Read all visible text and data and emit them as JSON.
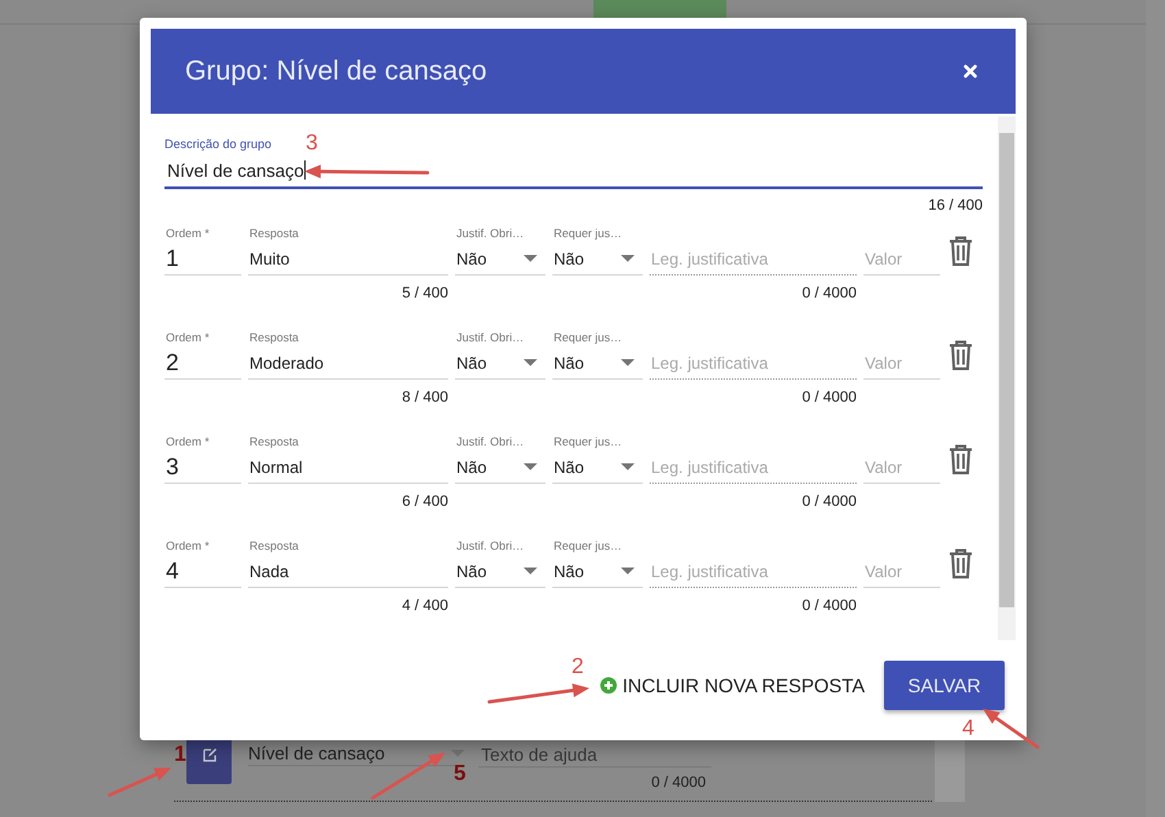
{
  "background_page": {
    "select_value": "Nível de cansaço",
    "help_placeholder": "Texto de ajuda",
    "counter": "0 / 4000"
  },
  "dialog": {
    "title": "Grupo: Nível de cansaço",
    "description_field": {
      "label": "Descrição do grupo",
      "value": "Nível de cansaço",
      "counter": "16 / 400",
      "focused": true
    },
    "answers": [
      {
        "order_label": "Ordem *",
        "order": "1",
        "answer_label": "Resposta",
        "answer": "Muito",
        "answer_counter": "5 / 400",
        "justif_label": "Justif. Obri…",
        "justif_value": "Não",
        "require_label": "Requer jus…",
        "require_value": "Não",
        "legend_placeholder": "Leg. justificativa",
        "legend_counter": "0 / 4000",
        "value_placeholder": "Valor"
      },
      {
        "order_label": "Ordem *",
        "order": "2",
        "answer_label": "Resposta",
        "answer": "Moderado",
        "answer_counter": "8 / 400",
        "justif_label": "Justif. Obri…",
        "justif_value": "Não",
        "require_label": "Requer jus…",
        "require_value": "Não",
        "legend_placeholder": "Leg. justificativa",
        "legend_counter": "0 / 4000",
        "value_placeholder": "Valor"
      },
      {
        "order_label": "Ordem *",
        "order": "3",
        "answer_label": "Resposta",
        "answer": "Normal",
        "answer_counter": "6 / 400",
        "justif_label": "Justif. Obri…",
        "justif_value": "Não",
        "require_label": "Requer jus…",
        "require_value": "Não",
        "legend_placeholder": "Leg. justificativa",
        "legend_counter": "0 / 4000",
        "value_placeholder": "Valor"
      },
      {
        "order_label": "Ordem *",
        "order": "4",
        "answer_label": "Resposta",
        "answer": "Nada",
        "answer_counter": "4 / 400",
        "justif_label": "Justif. Obri…",
        "justif_value": "Não",
        "require_label": "Requer jus…",
        "require_value": "Não",
        "legend_placeholder": "Leg. justificativa",
        "legend_counter": "0 / 4000",
        "value_placeholder": "Valor"
      }
    ],
    "add_button": "INCLUIR NOVA RESPOSTA",
    "save_button": "SALVAR"
  },
  "annotations": [
    {
      "label": "1"
    },
    {
      "label": "2"
    },
    {
      "label": "3"
    },
    {
      "label": "4"
    },
    {
      "label": "5"
    }
  ]
}
